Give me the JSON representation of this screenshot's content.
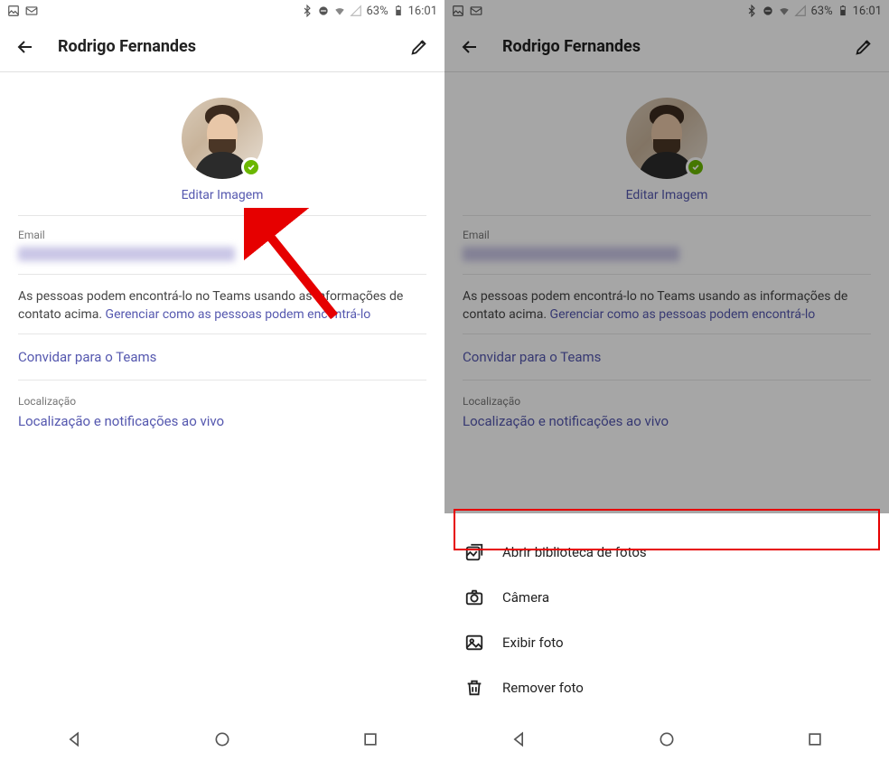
{
  "status": {
    "battery_pct": "63%",
    "time": "16:01"
  },
  "toolbar": {
    "title": "Rodrigo Fernandes"
  },
  "profile": {
    "edit_image": "Editar Imagem"
  },
  "email_section": {
    "label": "Email"
  },
  "help": {
    "text": "As pessoas podem encontrá-lo no Teams usando as informações de contato acima. ",
    "link": "Gerenciar como as pessoas podem encontrá-lo"
  },
  "invite": {
    "label": "Convidar para o Teams"
  },
  "location": {
    "label": "Localização",
    "link": "Localização e notificações ao vivo"
  },
  "sheet": {
    "open_library": "Abrir biblioteca de fotos",
    "camera": "Câmera",
    "view_photo": "Exibir foto",
    "remove_photo": "Remover foto"
  }
}
